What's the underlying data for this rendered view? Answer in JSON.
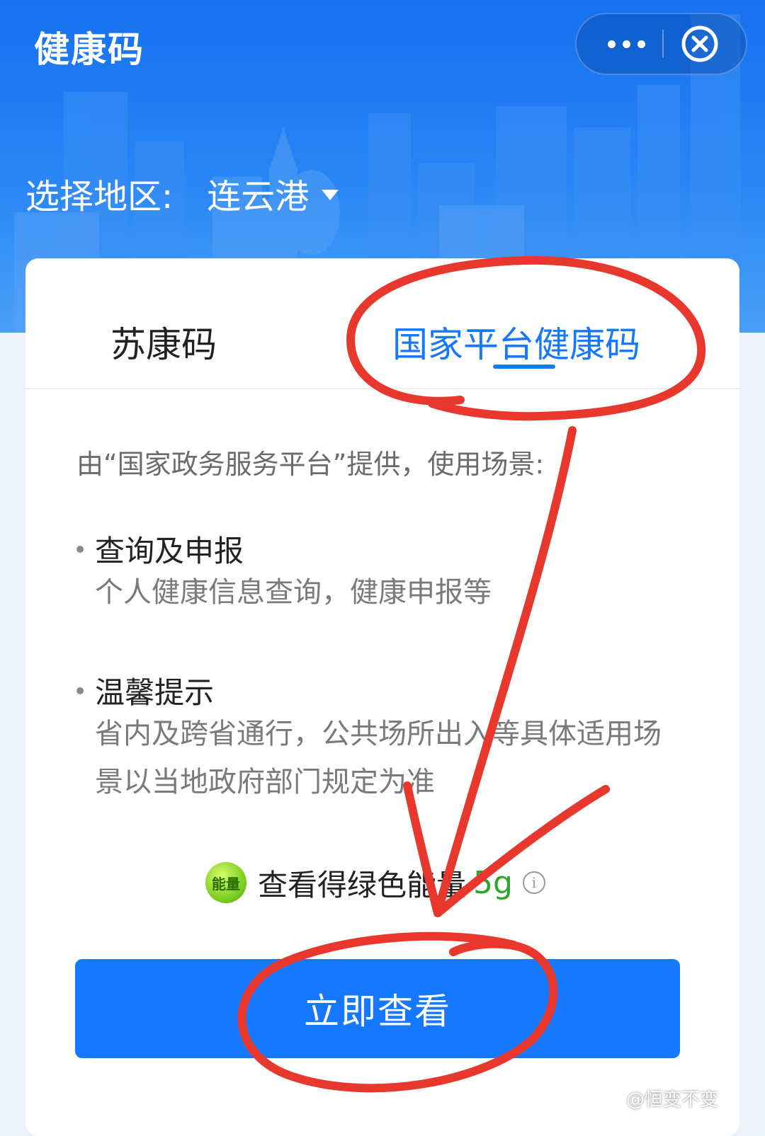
{
  "header": {
    "title": "健康码",
    "more_icon": "more-dots-icon",
    "close_icon": "close-circle-icon"
  },
  "region": {
    "label": "选择地区:",
    "value": "连云港"
  },
  "tabs": [
    {
      "label": "苏康码",
      "active": false
    },
    {
      "label": "国家平台健康码",
      "active": true
    }
  ],
  "content": {
    "description": "由“国家政务服务平台”提供，使用场景:",
    "sections": [
      {
        "title": "查询及申报",
        "body": "个人健康信息查询，健康申报等"
      },
      {
        "title": "温馨提示",
        "body": "省内及跨省通行，公共场所出入等具体适用场景以当地政府部门规定为准"
      }
    ]
  },
  "energy": {
    "badge": "能量",
    "text": "查看得绿色能量",
    "amount": "5g"
  },
  "action": {
    "button_label": "立即查看"
  },
  "watermark": "@恒变不变",
  "colors": {
    "primary": "#1677ff",
    "annotation": "#e8372c",
    "energy_green": "#2aa62a"
  }
}
